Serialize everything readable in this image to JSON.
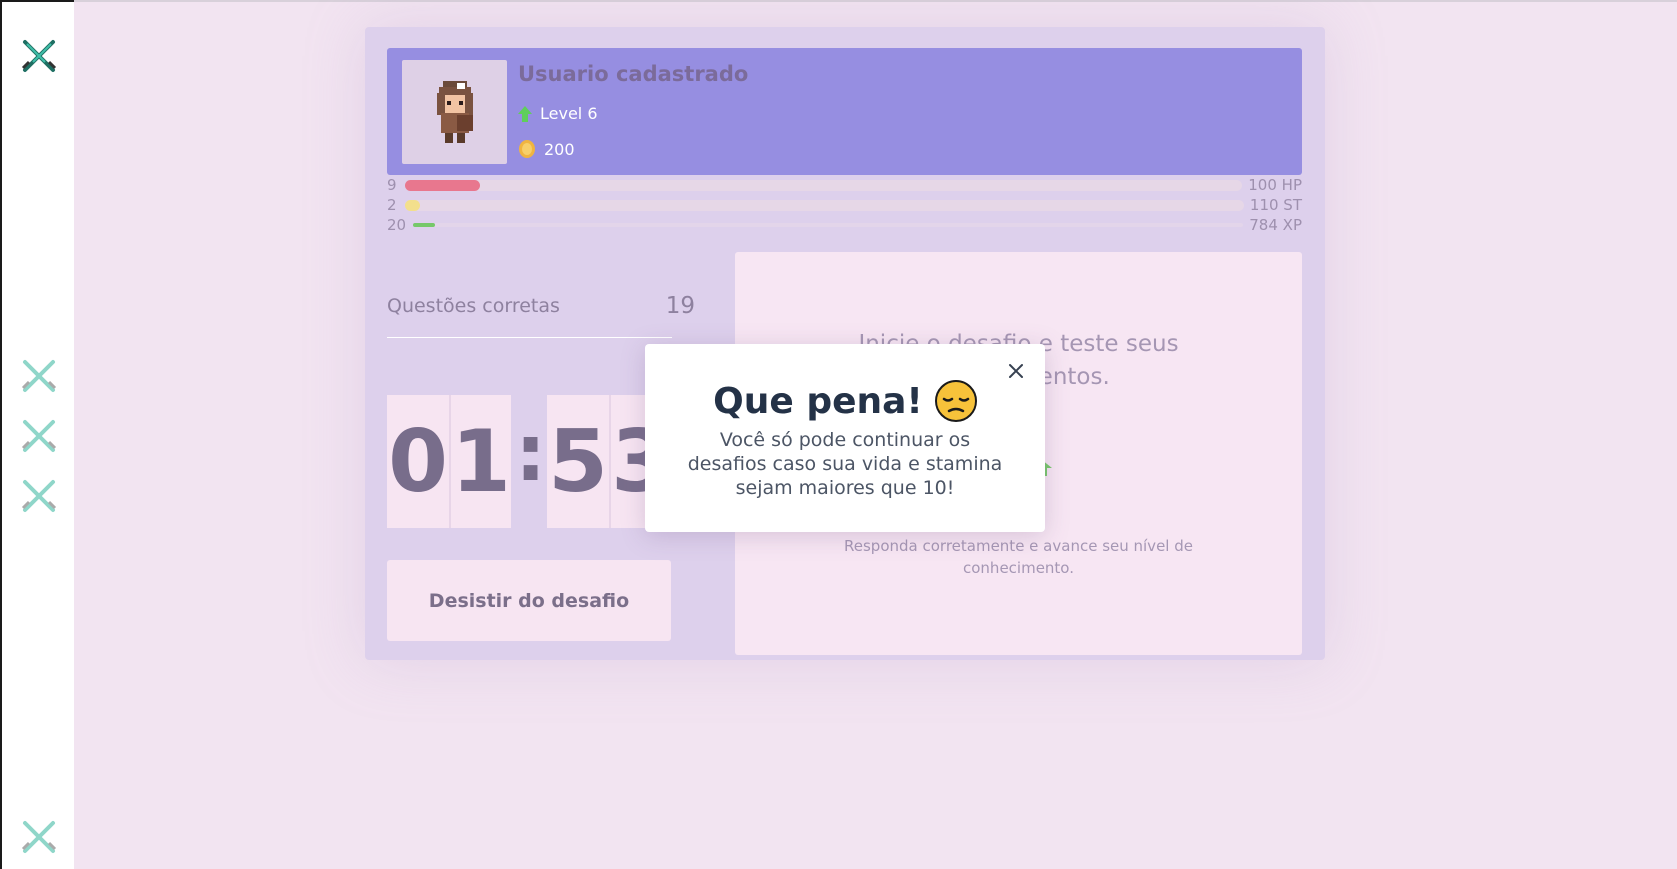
{
  "sidebar": {
    "icons": [
      "crossed-swords-icon",
      "crossed-swords-icon",
      "crossed-swords-icon",
      "crossed-swords-icon",
      "crossed-swords-icon"
    ]
  },
  "profile": {
    "name": "Usuario cadastrado",
    "level_label": "Level 6",
    "coins": "200"
  },
  "bars": [
    {
      "name": "hp",
      "current": "9",
      "max_label": "100 HP",
      "fraction": 0.09,
      "color": "#e8778e"
    },
    {
      "name": "st",
      "current": "2",
      "max_label": "110 ST",
      "fraction": 0.018,
      "color": "#f3df8c"
    },
    {
      "name": "xp",
      "current": "20",
      "max_label": "784 XP",
      "fraction": 0.026,
      "color": "#76c86a"
    }
  ],
  "stats": {
    "correct_label": "Questões corretas",
    "correct_value": "19"
  },
  "timer": {
    "min_tens": "0",
    "min_ones": "1",
    "separator": ":",
    "sec_tens": "5",
    "sec_ones": "3"
  },
  "quit_button": "Desistir do desafio",
  "challenge_card": {
    "title": "Inicie o desafio e teste seus conhecimentos.",
    "subtitle": "Responda corretamente e avance seu nível de conhecimento."
  },
  "modal": {
    "title": "Que pena!",
    "emoji": "pensive-face-icon",
    "message": "Você só pode continuar os desafios caso sua vida e stamina sejam maiores que 10!"
  },
  "colors": {
    "profile_bg": "#968ee1",
    "container_bg": "#ddd0ec",
    "page_bg": "#f2e4f1",
    "card_bg": "#f7e6f3"
  }
}
